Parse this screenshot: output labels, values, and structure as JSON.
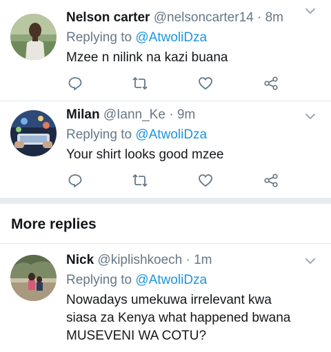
{
  "tweets": [
    {
      "name": "Nelson carter",
      "handle": "@nelsoncarter14",
      "time": "8m",
      "replying_prefix": "Replying to",
      "replying_to": "@AtwoliDza",
      "text": "Mzee n nilink na kazi buana"
    },
    {
      "name": "Milan",
      "handle": "@Iann_Ke",
      "time": "9m",
      "replying_prefix": "Replying to",
      "replying_to": "@AtwoliDza",
      "text": "Your shirt looks good mzee"
    },
    {
      "name": "Nick",
      "handle": "@kiplishkoech",
      "time": "1m",
      "replying_prefix": "Replying to",
      "replying_to": "@AtwoliDza",
      "text": "Nowadays umekuwa irrelevant kwa siasa za Kenya what happened bwana MUSEVENI WA COTU?"
    }
  ],
  "section": {
    "more_replies": "More replies"
  },
  "separator": "·",
  "icons": {
    "reply": "reply-icon",
    "retweet": "retweet-icon",
    "like": "heart-icon",
    "share": "share-icon",
    "menu": "chevron-down-icon"
  },
  "colors": {
    "mention": "#1b95e0",
    "meta": "#657786",
    "text": "#14171a",
    "divider": "#e1e8ed"
  }
}
